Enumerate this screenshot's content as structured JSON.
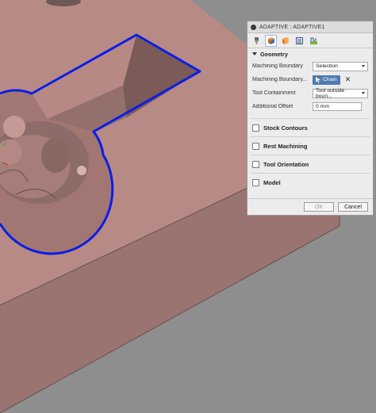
{
  "panel": {
    "title": "ADAPTIVE : ADAPTIVE1",
    "tabs": [
      {
        "icon": "tool-icon"
      },
      {
        "icon": "geometry-icon"
      },
      {
        "icon": "heights-icon"
      },
      {
        "icon": "passes-icon"
      },
      {
        "icon": "linking-icon"
      }
    ],
    "geometry": {
      "heading": "Geometry",
      "machining_boundary_label": "Machining Boundary",
      "machining_boundary_value": "Selection",
      "boundary_selection_label": "Machining Boundary...",
      "chain_label": "Chain",
      "tool_containment_label": "Tool Containment",
      "tool_containment_value": "Tool outside boun...",
      "additional_offset_label": "Additional Offset",
      "additional_offset_value": "0 mm"
    },
    "groups": [
      {
        "label": "Stock Contours"
      },
      {
        "label": "Rest Machining"
      },
      {
        "label": "Tool Orientation"
      },
      {
        "label": "Model"
      }
    ],
    "buttons": {
      "ok": "OK",
      "cancel": "Cancel"
    }
  },
  "colors": {
    "part": "#b88a86",
    "part_side_dark": "#8f6f6c",
    "part_side_light": "#a57f7c",
    "boundary": "#0a1ee6",
    "background": "#8e8e8e",
    "chain_button": "#4e7bb0"
  }
}
